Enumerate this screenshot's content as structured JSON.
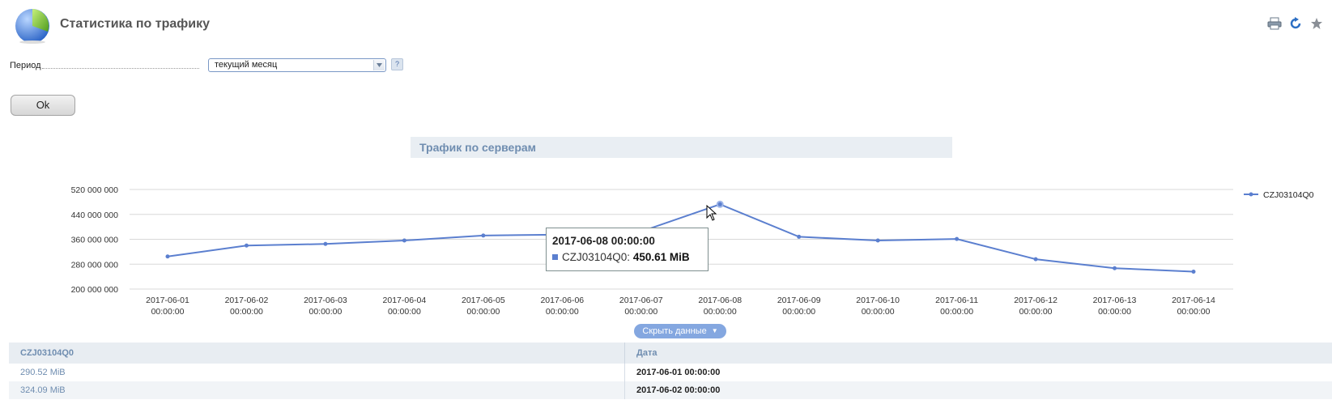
{
  "header": {
    "title": "Статистика по трафику"
  },
  "toolbar": {
    "icons": [
      "printer-icon",
      "refresh-icon",
      "star-icon"
    ]
  },
  "form": {
    "period_label": "Период",
    "period_value": "текущий месяц",
    "help_label": "?",
    "ok_label": "Ok"
  },
  "chart_title": "Трафик по серверам",
  "chart_data": {
    "type": "line",
    "x": [
      "2017-06-01 00:00:00",
      "2017-06-02 00:00:00",
      "2017-06-03 00:00:00",
      "2017-06-04 00:00:00",
      "2017-06-05 00:00:00",
      "2017-06-06 00:00:00",
      "2017-06-07 00:00:00",
      "2017-06-08 00:00:00",
      "2017-06-09 00:00:00",
      "2017-06-10 00:00:00",
      "2017-06-11 00:00:00",
      "2017-06-12 00:00:00",
      "2017-06-13 00:00:00",
      "2017-06-14 00:00:00"
    ],
    "x_tick_labels": [
      [
        "2017-06-01",
        "00:00:00"
      ],
      [
        "2017-06-02",
        "00:00:00"
      ],
      [
        "2017-06-03",
        "00:00:00"
      ],
      [
        "2017-06-04",
        "00:00:00"
      ],
      [
        "2017-06-05",
        "00:00:00"
      ],
      [
        "2017-06-06",
        "00:00:00"
      ],
      [
        "2017-06-07",
        "00:00:00"
      ],
      [
        "2017-06-08",
        "00:00:00"
      ],
      [
        "2017-06-09",
        "00:00:00"
      ],
      [
        "2017-06-10",
        "00:00:00"
      ],
      [
        "2017-06-11",
        "00:00:00"
      ],
      [
        "2017-06-12",
        "00:00:00"
      ],
      [
        "2017-06-13",
        "00:00:00"
      ],
      [
        "2017-06-14",
        "00:00:00"
      ]
    ],
    "series": [
      {
        "name": "CZJ03104Q0",
        "color": "#5b7fcf",
        "values": [
          304633856,
          339833283,
          345000000,
          356000000,
          372000000,
          375000000,
          385000000,
          472363827,
          368000000,
          356000000,
          361000000,
          296000000,
          267000000,
          256000000
        ]
      }
    ],
    "y_ticks": [
      "200 000 000",
      "280 000 000",
      "360 000 000",
      "440 000 000",
      "520 000 000"
    ],
    "y_tick_values": [
      200000000,
      280000000,
      360000000,
      440000000,
      520000000
    ],
    "ylim": [
      200000000,
      520000000
    ],
    "grid": true,
    "legend": "top-right"
  },
  "tooltip": {
    "date": "2017-06-08 00:00:00",
    "series": "CZJ03104Q0:",
    "value": "450.61 MiB"
  },
  "hide_data_label": "Скрыть данные",
  "table": {
    "headers": [
      "CZJ03104Q0",
      "Дата"
    ],
    "rows": [
      [
        "290.52 MiB",
        "2017-06-01 00:00:00"
      ],
      [
        "324.09 MiB",
        "2017-06-02 00:00:00"
      ]
    ]
  }
}
